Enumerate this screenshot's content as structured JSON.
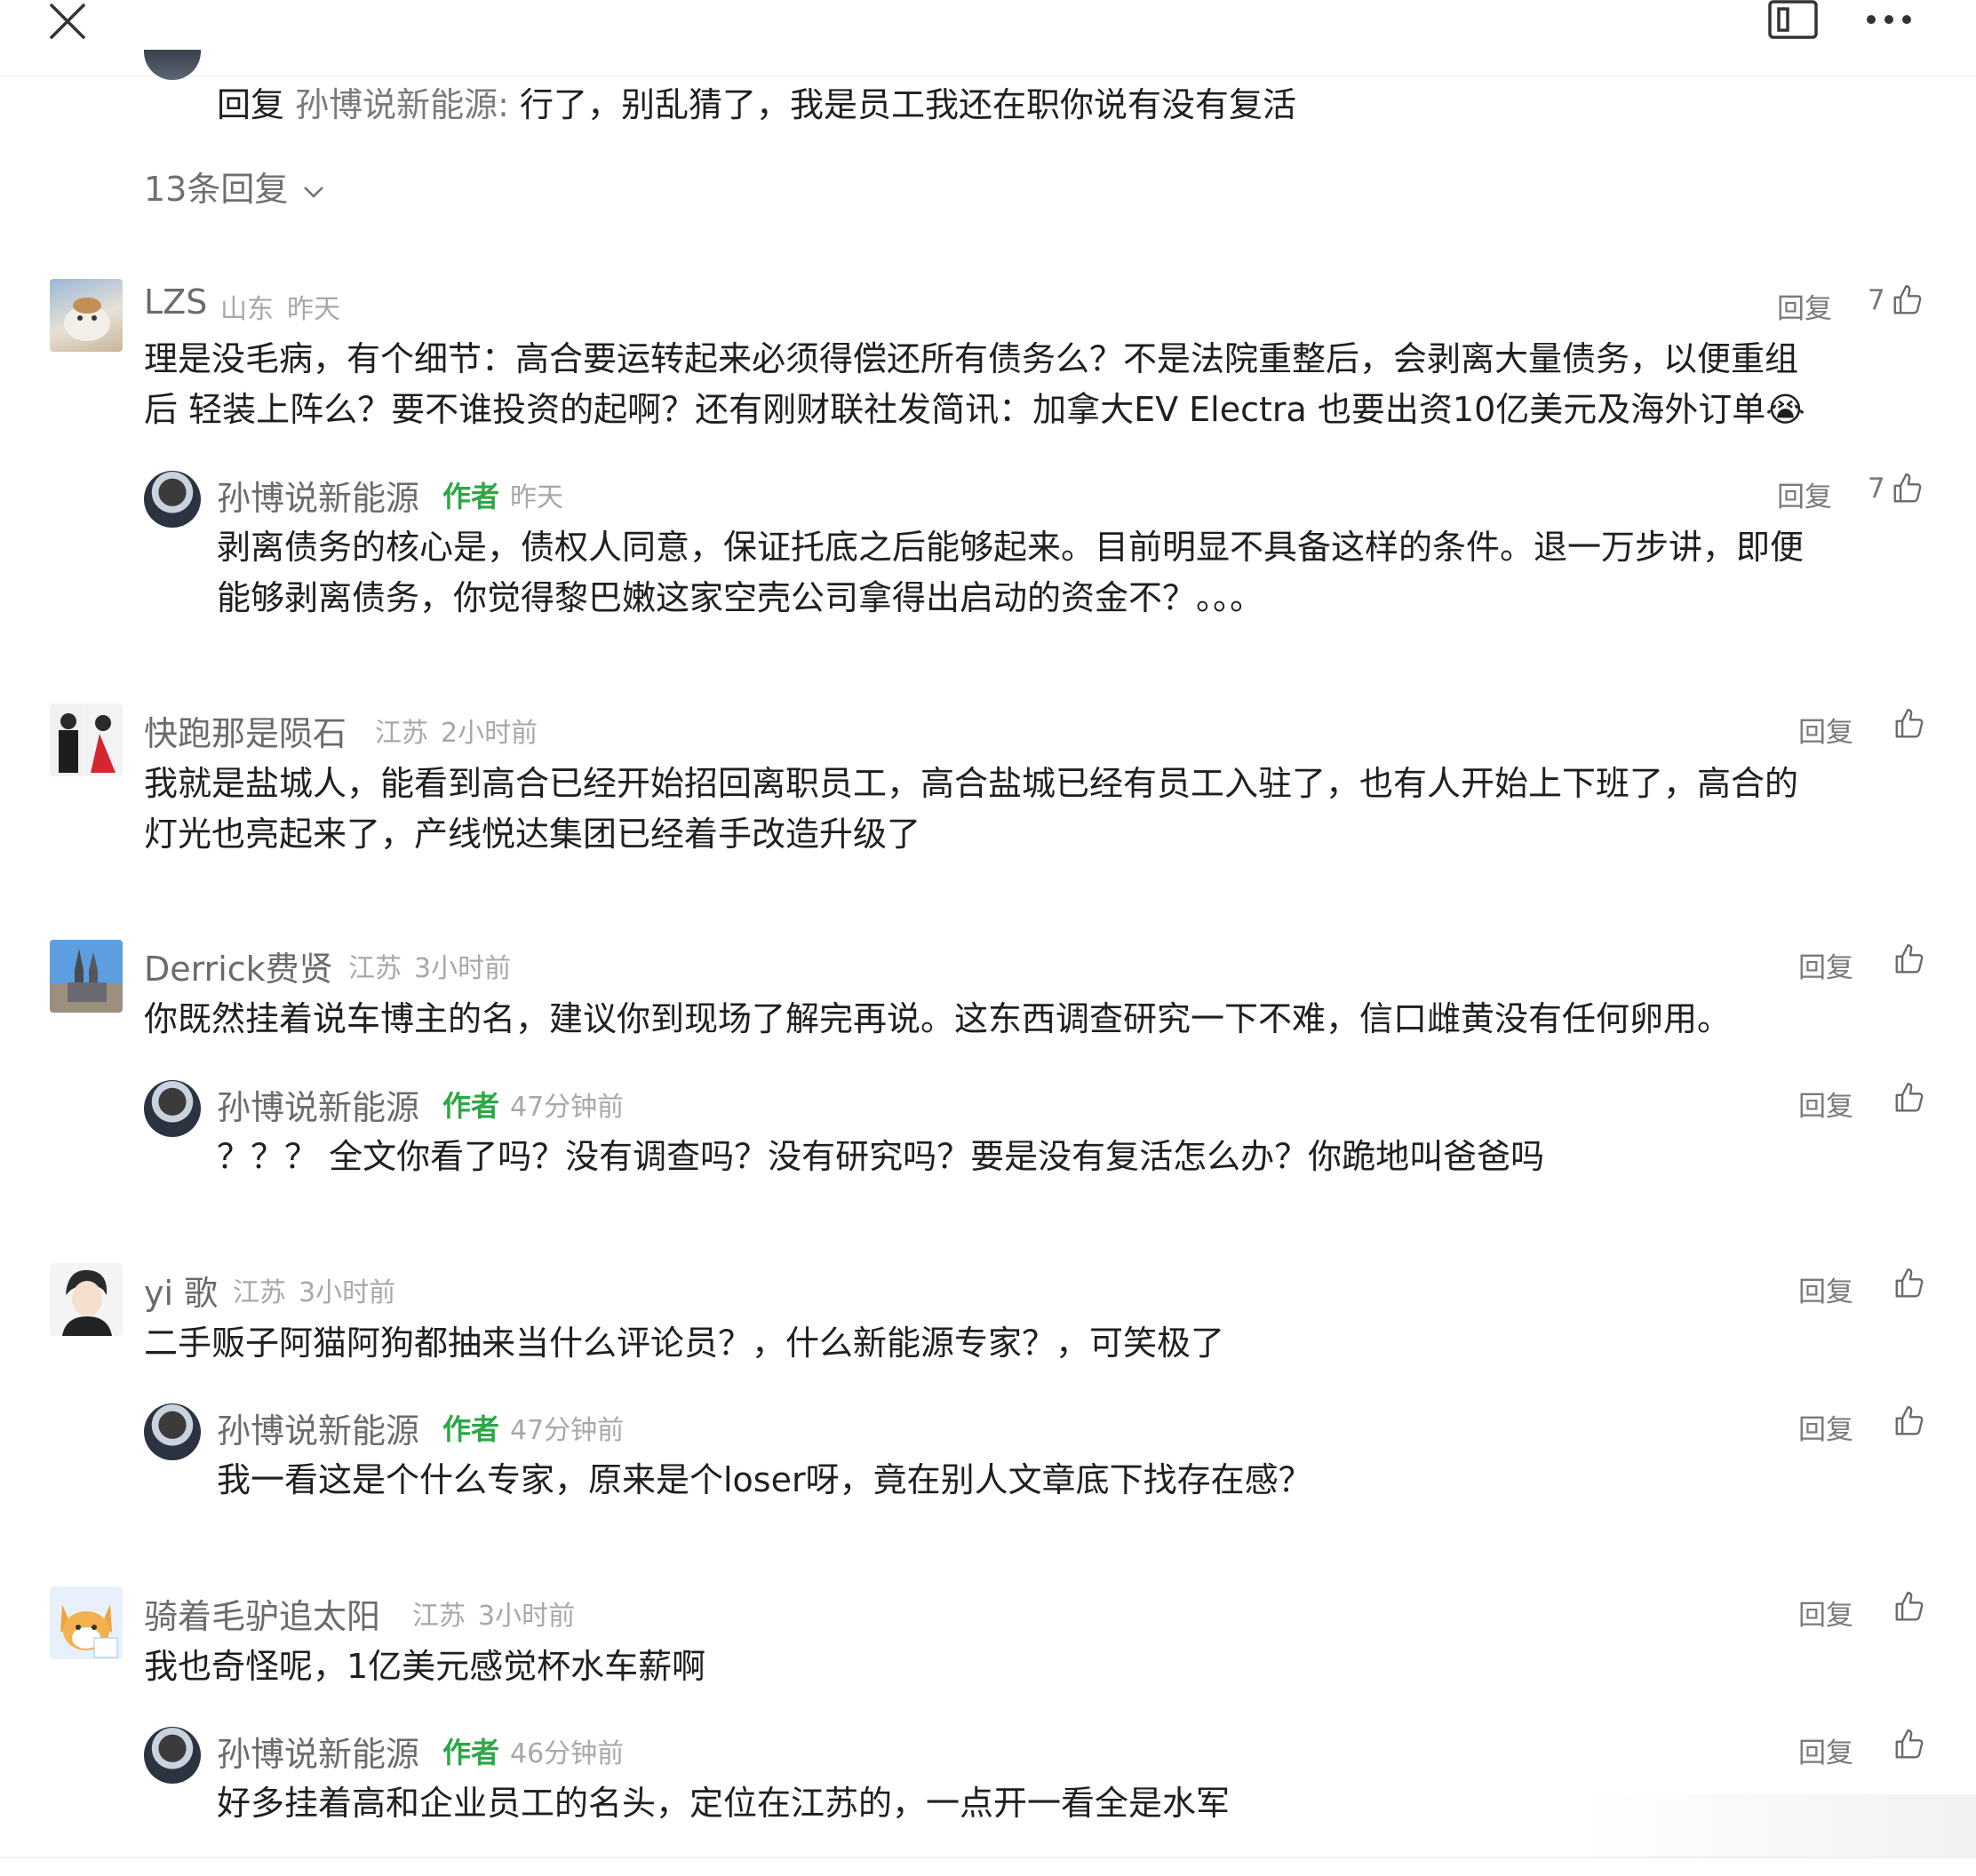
{
  "topbar": {
    "close_icon": "close-icon",
    "panel_icon": "panel-icon",
    "more_icon": "more-icon"
  },
  "header_reply": {
    "prefix": "回复 ",
    "target": "孙博说新能源:",
    "text": " 行了，别乱猜了，我是员工我还在职你说有没有复活",
    "expand_label": "13条回复"
  },
  "comments": [
    {
      "user": "LZS",
      "location": "山东",
      "time": "昨天",
      "reply_label": "回复",
      "likes": "7",
      "lines": [
        "理是没毛病，有个细节：高合要运转起来必须得偿还所有债务么？不是法院重整后，会剥离大量债务，以便重组",
        "后 轻装上阵么？要不谁投资的起啊？还有刚财联社发简讯：加拿大EV Electra 也要出资10亿美元及海外订单"
      ],
      "emoji": "😭",
      "sub": {
        "user": "孙博说新能源",
        "tag": "作者",
        "time": "昨天",
        "reply_label": "回复",
        "likes": "7",
        "lines": [
          "剥离债务的核心是，债权人同意，保证托底之后能够起来。目前明显不具备这样的条件。退一万步讲，即便",
          "能够剥离债务，你觉得黎巴嫩这家空壳公司拿得出启动的资金不？。。。"
        ]
      }
    },
    {
      "user": "快跑那是陨石",
      "location": "江苏",
      "time": "2小时前",
      "reply_label": "回复",
      "lines": [
        "我就是盐城人，能看到高合已经开始招回离职员工，高合盐城已经有员工入驻了，也有人开始上下班了，高合的",
        "灯光也亮起来了，产线悦达集团已经着手改造升级了"
      ]
    },
    {
      "user": "Derrick费贤",
      "location": "江苏",
      "time": "3小时前",
      "reply_label": "回复",
      "lines": [
        "你既然挂着说车博主的名，建议你到现场了解完再说。这东西调查研究一下不难，信口雌黄没有任何卵用。"
      ],
      "sub": {
        "user": "孙博说新能源",
        "tag": "作者",
        "time": "47分钟前",
        "reply_label": "回复",
        "lines": [
          "？？？ 全文你看了吗？没有调查吗？没有研究吗？要是没有复活怎么办？你跪地叫爸爸吗"
        ]
      }
    },
    {
      "user": "yi 歌",
      "location": "江苏",
      "time": "3小时前",
      "reply_label": "回复",
      "lines": [
        "二手贩子阿猫阿狗都抽来当什么评论员？，什么新能源专家？，可笑极了"
      ],
      "sub": {
        "user": "孙博说新能源",
        "tag": "作者",
        "time": "47分钟前",
        "reply_label": "回复",
        "lines": [
          "我一看这是个什么专家，原来是个loser呀，竟在别人文章底下找存在感？"
        ]
      }
    },
    {
      "user": "骑着毛驴追太阳",
      "location": "江苏",
      "time": "3小时前",
      "reply_label": "回复",
      "lines": [
        "我也奇怪呢，1亿美元感觉杯水车薪啊"
      ],
      "sub": {
        "user": "孙博说新能源",
        "tag": "作者",
        "time": "46分钟前",
        "reply_label": "回复",
        "lines": [
          "好多挂着高和企业员工的名头，定位在江苏的，一点开一看全是水军"
        ]
      }
    }
  ],
  "colors": {
    "author_green": "#2aa845",
    "muted": "#a8a8a8",
    "name": "#6b6b6b"
  }
}
